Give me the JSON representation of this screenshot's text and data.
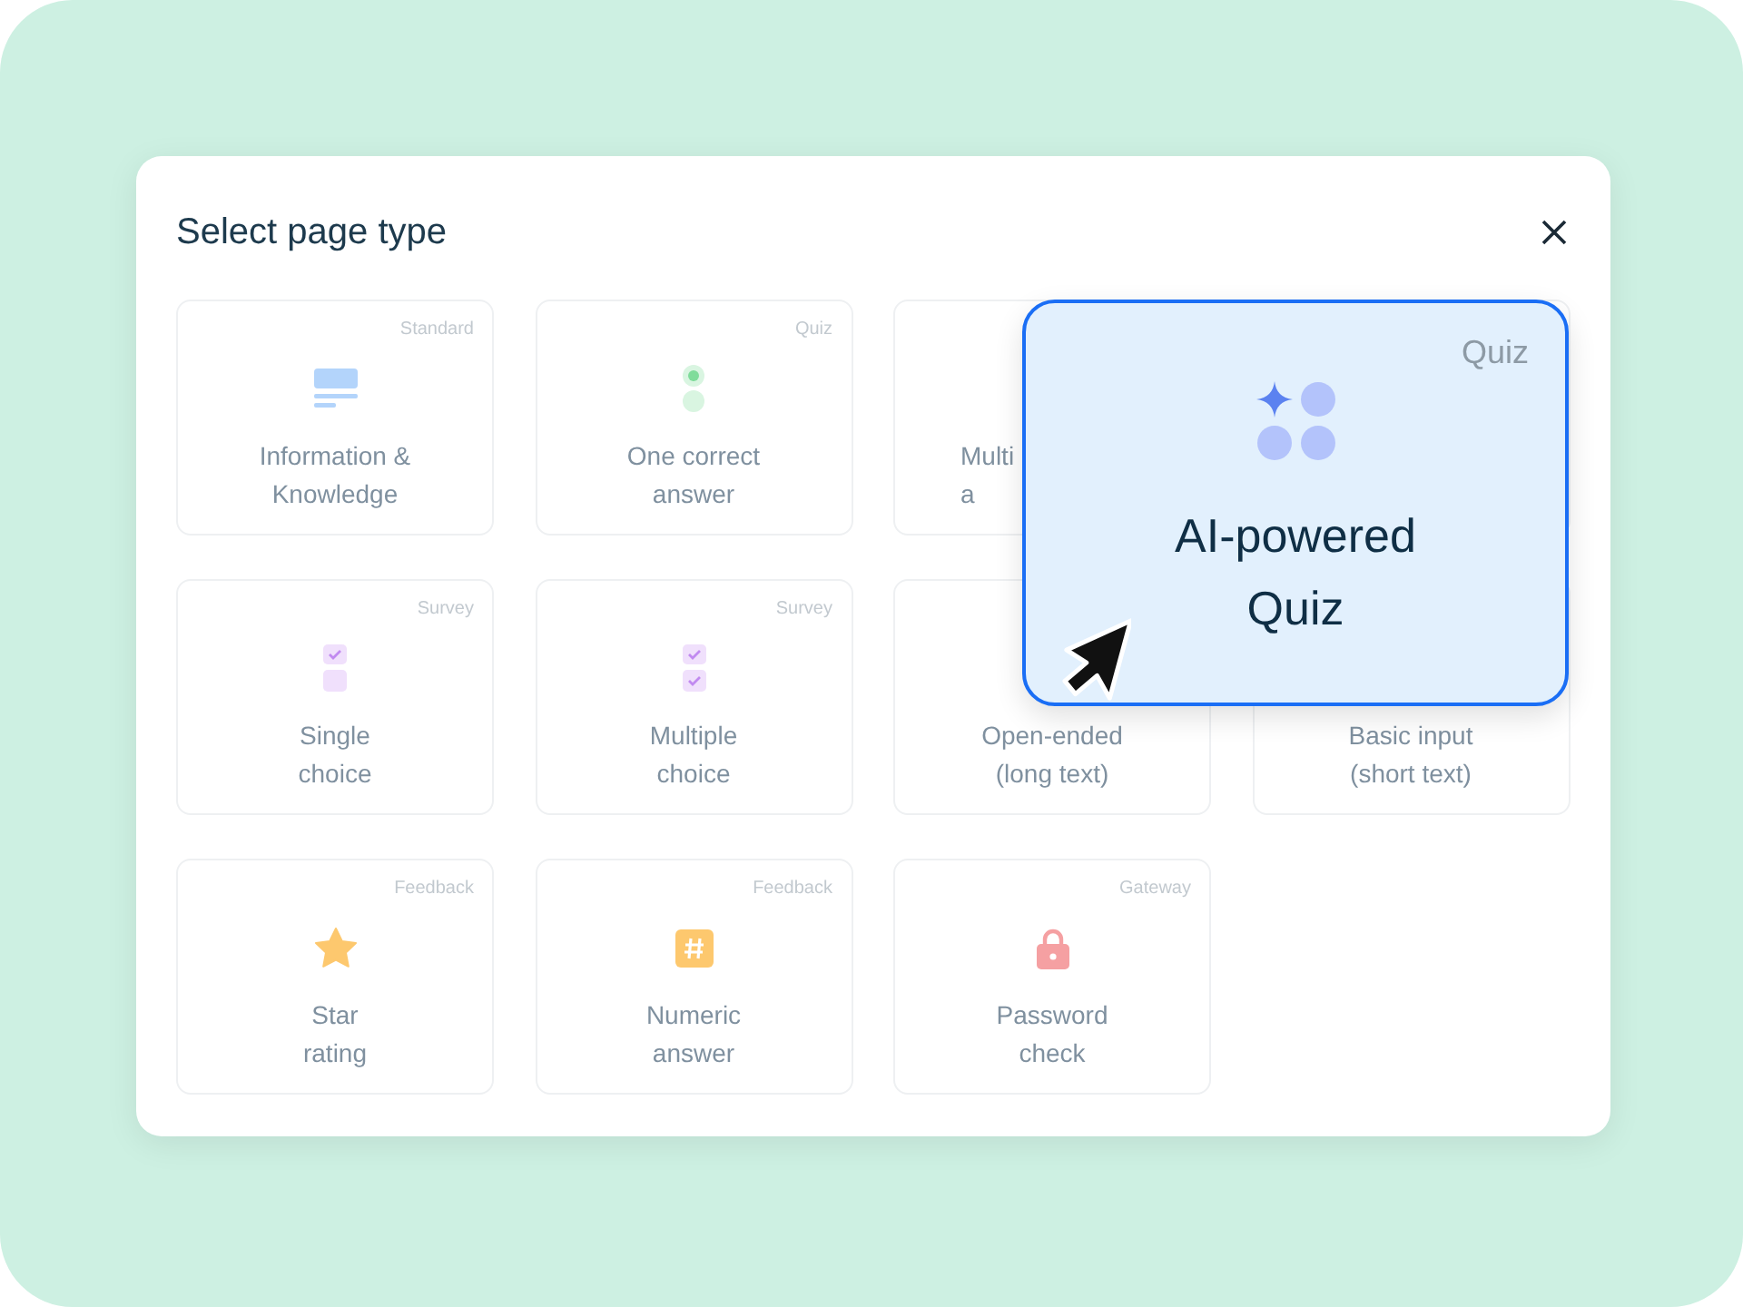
{
  "dialog": {
    "title": "Select page type"
  },
  "cards": [
    {
      "kind": "info",
      "category": "Standard",
      "label": "Information &\nKnowledge"
    },
    {
      "kind": "radio",
      "category": "Quiz",
      "label": "One correct\nanswer"
    },
    {
      "kind": "partial",
      "label": "Multi\na"
    },
    {
      "kind": "covered"
    },
    {
      "kind": "single",
      "category": "Survey",
      "label": "Single\nchoice"
    },
    {
      "kind": "multi",
      "category": "Survey",
      "label": "Multiple\nchoice"
    },
    {
      "kind": "covered",
      "label": "Open-ended\n(long text)"
    },
    {
      "kind": "covered",
      "label": "Basic input\n(short text)"
    },
    {
      "kind": "star",
      "category": "Feedback",
      "label": "Star\nrating"
    },
    {
      "kind": "hash",
      "category": "Feedback",
      "label": "Numeric\nanswer"
    },
    {
      "kind": "lock",
      "category": "Gateway",
      "label": "Password\ncheck"
    }
  ],
  "featured": {
    "kind": "ai",
    "category": "Quiz",
    "title": "AI-powered\nQuiz"
  }
}
